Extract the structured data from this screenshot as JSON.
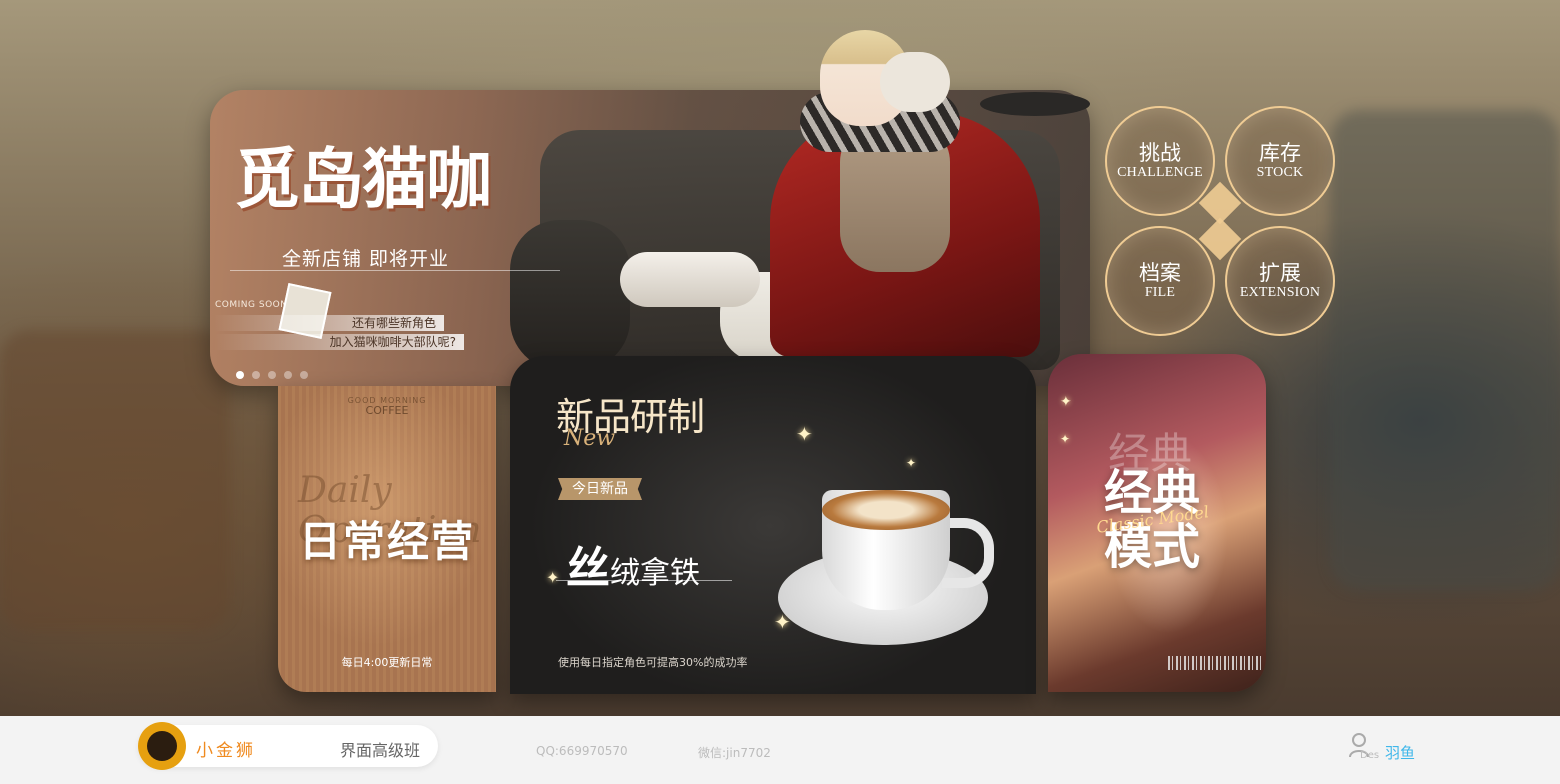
{
  "banner": {
    "title": "觅岛猫咖",
    "subtitle": "全新店铺  即将开业",
    "coming_soon": "COMING SOON",
    "tag1": "还有哪些新角色",
    "tag2": "加入猫咪咖啡大部队呢?",
    "dots": 5,
    "active_dot": 1
  },
  "menu": [
    {
      "cn": "挑战",
      "en": "CHALLENGE"
    },
    {
      "cn": "库存",
      "en": "STOCK"
    },
    {
      "cn": "档案",
      "en": "FILE"
    },
    {
      "cn": "扩展",
      "en": "EXTENSION"
    }
  ],
  "daily": {
    "good_morning": "GOOD MORNING",
    "coffee": "COFFEE",
    "deco": "Daily\nOperation",
    "title": "日常经营",
    "footer": "每日4:00更新日常"
  },
  "new_product": {
    "title": "新品研制",
    "title_en": "New",
    "badge": "今日新品",
    "name_big": "丝",
    "name_rest": "绒拿铁",
    "footer": "使用每日指定角色可提高30%的成功率"
  },
  "classic": {
    "ghost": "经典",
    "title_line1": "经典",
    "title_line2": "模式",
    "title_en": "Classic Model"
  },
  "footer": {
    "brand": "小金狮",
    "course": "界面高级班",
    "qq": "QQ:669970570",
    "wechat": "微信:jin7702",
    "des": "Des",
    "author": "羽鱼"
  },
  "colors": {
    "accent_gold": "#f0cc94",
    "brand_orange": "#ef8a1f",
    "author_blue": "#3fb7ea"
  }
}
